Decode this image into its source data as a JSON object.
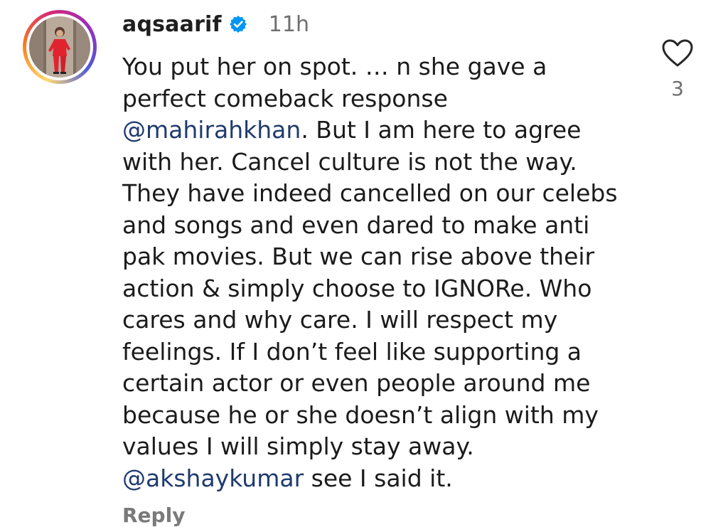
{
  "comment": {
    "username": "aqsaarif",
    "verified": true,
    "verified_icon": "verified-badge-icon",
    "time": "11h",
    "lines": [
      {
        "text": "You put her on spot. … n she gave a"
      },
      {
        "text": "perfect comeback response"
      },
      {
        "mention": "@mahirahkhan",
        "text": ". But I am here to agree"
      },
      {
        "text": "with her. Cancel culture is not the way."
      },
      {
        "text": "They have indeed cancelled on our celebs"
      },
      {
        "text": "and songs and even dared to make anti"
      },
      {
        "text": "pak movies. But we can rise above their"
      },
      {
        "text": "action & simply choose to IGNORe. Who"
      },
      {
        "text": "cares and why care. I will respect my"
      },
      {
        "text": "feelings. If I don’t feel like supporting a"
      },
      {
        "text": "certain actor or even people around me"
      },
      {
        "text": "because he or she doesn’t align with my"
      },
      {
        "text": "values I will simply stay away."
      },
      {
        "mention": "@akshaykumar",
        "text": " see I said it."
      }
    ],
    "like_icon": "heart-outline-icon",
    "like_count": "3",
    "reply_label": "Reply"
  },
  "colors": {
    "text": "#1b1b1b",
    "mention": "#1f3b6e",
    "muted": "#6f6f6f",
    "verified_blue": "#0095f6",
    "avatar_outfit": "#e0242f"
  }
}
